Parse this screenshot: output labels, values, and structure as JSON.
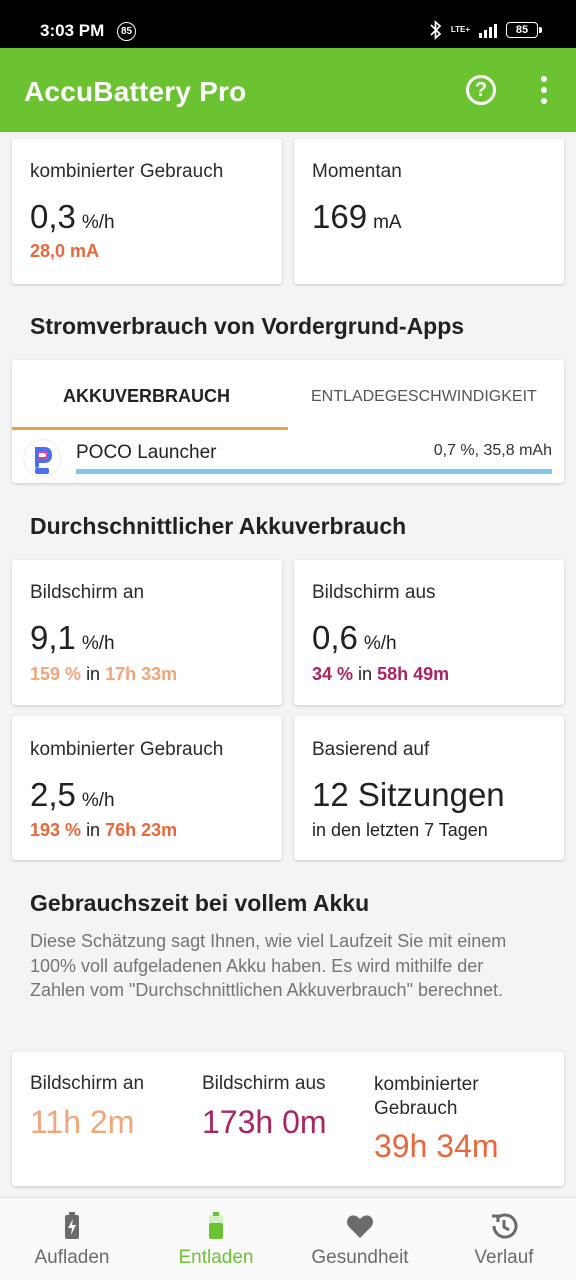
{
  "status_bar": {
    "time": "3:03 PM",
    "notification_badge": "85",
    "network": "LTE+",
    "battery": "85"
  },
  "app_bar": {
    "title": "AccuBattery Pro",
    "help_icon": "help-circle-icon",
    "menu_icon": "more-vert-icon"
  },
  "current": {
    "combined": {
      "label": "kombinierter Gebrauch",
      "value": "0,3",
      "unit": "%/h",
      "sub": "28,0 mA"
    },
    "momentary": {
      "label": "Momentan",
      "value": "169",
      "unit": "mA"
    }
  },
  "foreground_apps": {
    "title": "Stromverbrauch von Vordergrund-Apps",
    "tabs": [
      "AKKUVERBRAUCH",
      "ENTLADEGESCHWINDIGKEIT"
    ],
    "apps": [
      {
        "name": "POCO Launcher",
        "stats": "0,7 %, 35,8 mAh",
        "share": 1.0
      }
    ]
  },
  "average": {
    "title": "Durchschnittlicher Akkuverbrauch",
    "screen_on": {
      "label": "Bildschirm an",
      "value": "9,1",
      "unit": "%/h",
      "percent": "159 %",
      "in": "in",
      "time": "17h 33m"
    },
    "screen_off": {
      "label": "Bildschirm aus",
      "value": "0,6",
      "unit": "%/h",
      "percent": "34 %",
      "in": "in",
      "time": "58h 49m"
    },
    "combined": {
      "label": "kombinierter Gebrauch",
      "value": "2,5",
      "unit": "%/h",
      "percent": "193 %",
      "in": "in",
      "time": "76h 23m"
    },
    "based_on": {
      "label": "Basierend auf",
      "value": "12 Sitzungen",
      "sub": "in den letzten 7 Tagen"
    }
  },
  "full_battery": {
    "title": "Gebrauchszeit bei vollem Akku",
    "description": "Diese Schätzung sagt Ihnen, wie viel Laufzeit Sie mit einem 100% voll aufgeladenen Akku haben. Es wird mithilfe der Zahlen vom \"Durchschnittlichen Akkuverbrauch\" berechnet.",
    "screen_on": {
      "label": "Bildschirm an",
      "value": "11h 2m"
    },
    "screen_off": {
      "label": "Bildschirm aus",
      "value": "173h 0m"
    },
    "combined": {
      "label": "kombinierter Gebrauch",
      "value": "39h 34m"
    }
  },
  "colors": {
    "accent_green": "#6cc332",
    "orange": "#e8673b",
    "peach": "#f0a57a",
    "purple": "#a82462",
    "bar_blue": "#82c8ea"
  },
  "bottom_nav": [
    {
      "label": "Aufladen",
      "icon": "battery-charging-icon"
    },
    {
      "label": "Entladen",
      "icon": "battery-icon",
      "active": true
    },
    {
      "label": "Gesundheit",
      "icon": "heart-icon"
    },
    {
      "label": "Verlauf",
      "icon": "history-icon"
    }
  ]
}
